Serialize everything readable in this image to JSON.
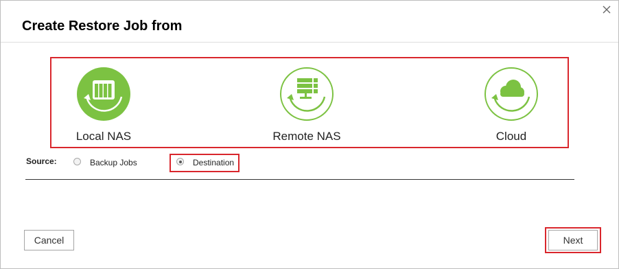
{
  "dialog": {
    "title": "Create Restore Job from",
    "close_icon": "close-icon"
  },
  "options": [
    {
      "label": "Local NAS",
      "icon": "local-nas-icon",
      "selected": true
    },
    {
      "label": "Remote NAS",
      "icon": "remote-nas-icon",
      "selected": false
    },
    {
      "label": "Cloud",
      "icon": "cloud-icon",
      "selected": false
    }
  ],
  "source": {
    "label": "Source:",
    "options": [
      {
        "label": "Backup Jobs",
        "checked": false
      },
      {
        "label": "Destination",
        "checked": true
      }
    ]
  },
  "buttons": {
    "cancel": "Cancel",
    "next": "Next"
  },
  "colors": {
    "accent_green": "#7cc242",
    "highlight_red": "#d9262c"
  }
}
